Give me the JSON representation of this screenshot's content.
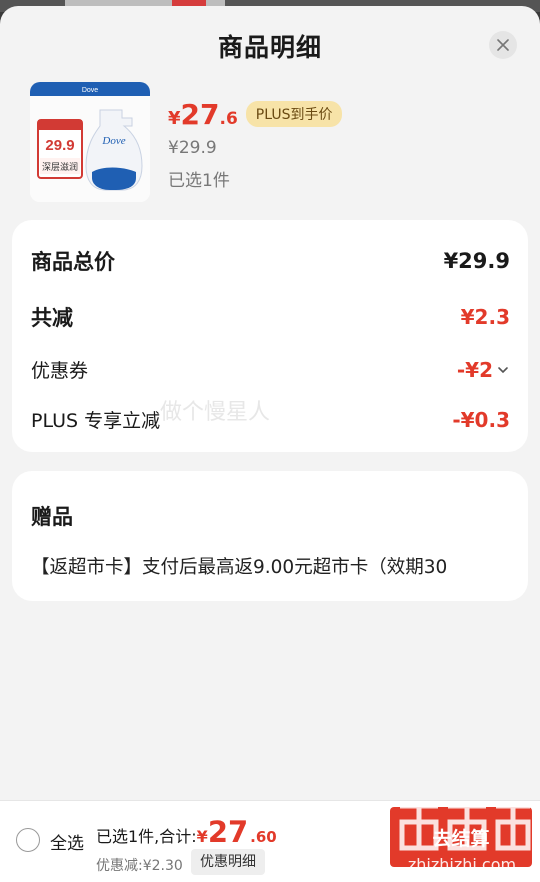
{
  "sheet": {
    "title": "商品明细"
  },
  "product": {
    "image_badge_price": "29.9",
    "image_badge_text": "深层滋润",
    "brand": "Dove",
    "price_currency": "¥",
    "price_int": "27",
    "price_dec": ".6",
    "plus_tag": "PLUS到手价",
    "original_price": "¥29.9",
    "selected_count": "已选1件"
  },
  "summary": {
    "total_label": "商品总价",
    "total_value": "¥29.9",
    "reduce_label": "共减",
    "reduce_value": "¥2.3",
    "coupon_label": "优惠券",
    "coupon_value": "-¥2",
    "plus_label": "PLUS 专享立减",
    "plus_value": "-¥0.3",
    "watermark": "做个慢星人"
  },
  "gift": {
    "title": "赠品",
    "text": "【返超市卡】支付后最高返9.00元超市卡（效期30"
  },
  "bottom_bar": {
    "select_all": "全选",
    "total_prefix": "已选1件,合计:",
    "currency": "¥",
    "total_int": "27",
    "total_dec": ".60",
    "discount_text": "优惠减:¥2.30",
    "detail_button": "优惠明细",
    "checkout_label": "去结算",
    "site_watermark": "zhizhizhi.com"
  },
  "colors": {
    "accent_red": "#e23a2a",
    "plus_gold": "#f7e3a8"
  }
}
